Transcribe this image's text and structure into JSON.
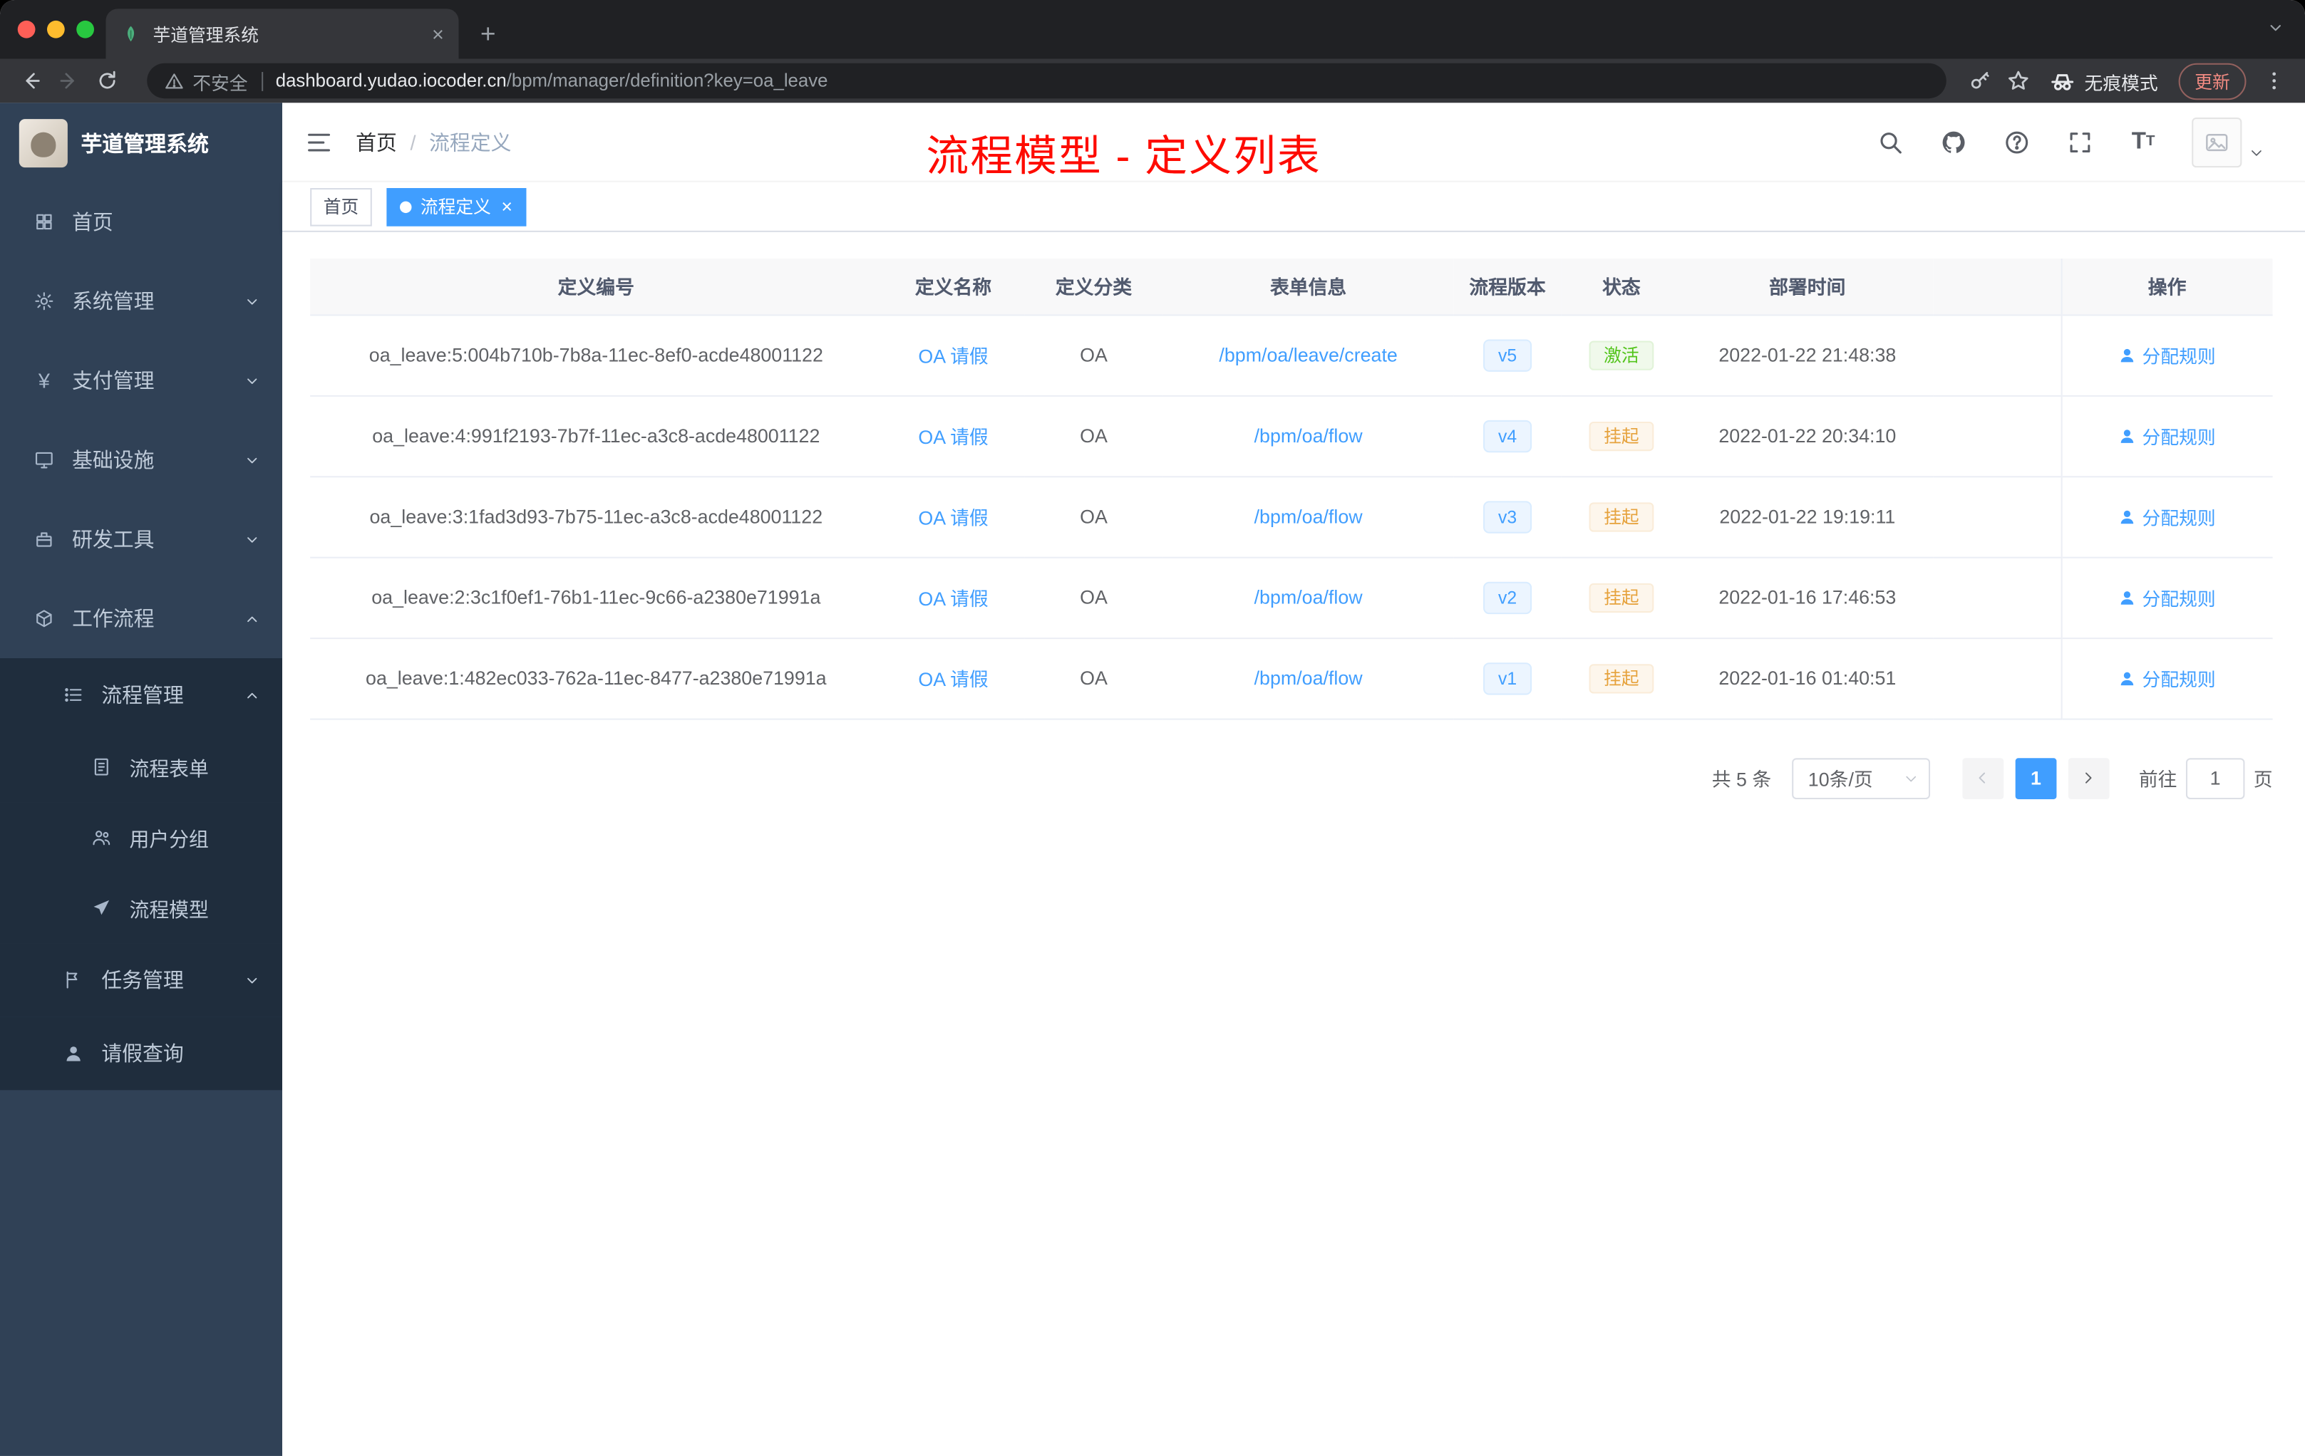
{
  "browser": {
    "tab": {
      "title": "芋道管理系统"
    },
    "address": {
      "security_label": "不安全",
      "url_domain": "dashboard.yudao.iocoder.cn",
      "url_path": "/bpm/manager/definition?key=oa_leave"
    },
    "incognito_label": "无痕模式",
    "update_label": "更新"
  },
  "sidebar": {
    "logo_title": "芋道管理系统",
    "items": [
      {
        "id": "home",
        "label": "首页",
        "icon": "dashboard-icon",
        "level": 1
      },
      {
        "id": "system",
        "label": "系统管理",
        "icon": "gear-icon",
        "level": 1,
        "arrow": "down"
      },
      {
        "id": "payment",
        "label": "支付管理",
        "icon": "yen-icon",
        "level": 1,
        "arrow": "down"
      },
      {
        "id": "infra",
        "label": "基础设施",
        "icon": "infra-icon",
        "level": 1,
        "arrow": "down"
      },
      {
        "id": "devtools",
        "label": "研发工具",
        "icon": "tools-icon",
        "level": 1,
        "arrow": "down"
      },
      {
        "id": "workflow",
        "label": "工作流程",
        "icon": "workflow-icon",
        "level": 1,
        "arrow": "up"
      },
      {
        "id": "process-manage",
        "label": "流程管理",
        "icon": "list-icon",
        "level": 2,
        "arrow": "up",
        "dark": true
      },
      {
        "id": "process-form",
        "label": "流程表单",
        "icon": "form-icon",
        "level": 3,
        "dark": true
      },
      {
        "id": "user-group",
        "label": "用户分组",
        "icon": "user-group-icon",
        "level": 3,
        "dark": true
      },
      {
        "id": "process-model",
        "label": "流程模型",
        "icon": "paper-plane-icon",
        "level": 3,
        "dark": true
      },
      {
        "id": "task-manage",
        "label": "任务管理",
        "icon": "flag-icon",
        "level": 2,
        "arrow": "down",
        "dark": true
      },
      {
        "id": "leave-query",
        "label": "请假查询",
        "icon": "person-icon",
        "level": 2,
        "dark": true
      }
    ]
  },
  "navbar": {
    "breadcrumb_home": "首页",
    "breadcrumb_separator": "/",
    "breadcrumb_current": "流程定义",
    "annotation": "流程模型 - 定义列表"
  },
  "tags": {
    "home_label": "首页",
    "active_label": "流程定义"
  },
  "table": {
    "columns": [
      "定义编号",
      "定义名称",
      "定义分类",
      "表单信息",
      "流程版本",
      "状态",
      "部署时间",
      "操作"
    ],
    "rows": [
      {
        "id": "oa_leave:5:004b710b-7b8a-11ec-8ef0-acde48001122",
        "name": "OA 请假",
        "category": "OA",
        "form": "/bpm/oa/leave/create",
        "version": "v5",
        "status": "激活",
        "status_type": "success",
        "time": "2022-01-22 21:48:38",
        "action": "分配规则"
      },
      {
        "id": "oa_leave:4:991f2193-7b7f-11ec-a3c8-acde48001122",
        "name": "OA 请假",
        "category": "OA",
        "form": "/bpm/oa/flow",
        "version": "v4",
        "status": "挂起",
        "status_type": "warning",
        "time": "2022-01-22 20:34:10",
        "action": "分配规则"
      },
      {
        "id": "oa_leave:3:1fad3d93-7b75-11ec-a3c8-acde48001122",
        "name": "OA 请假",
        "category": "OA",
        "form": "/bpm/oa/flow",
        "version": "v3",
        "status": "挂起",
        "status_type": "warning",
        "time": "2022-01-22 19:19:11",
        "action": "分配规则"
      },
      {
        "id": "oa_leave:2:3c1f0ef1-76b1-11ec-9c66-a2380e71991a",
        "name": "OA 请假",
        "category": "OA",
        "form": "/bpm/oa/flow",
        "version": "v2",
        "status": "挂起",
        "status_type": "warning",
        "time": "2022-01-16 17:46:53",
        "action": "分配规则"
      },
      {
        "id": "oa_leave:1:482ec033-762a-11ec-8477-a2380e71991a",
        "name": "OA 请假",
        "category": "OA",
        "form": "/bpm/oa/flow",
        "version": "v1",
        "status": "挂起",
        "status_type": "warning",
        "time": "2022-01-16 01:40:51",
        "action": "分配规则"
      }
    ]
  },
  "pagination": {
    "total_label": "共 5 条",
    "page_size_label": "10条/页",
    "current_page": "1",
    "goto_label": "前往",
    "goto_value": "1",
    "page_unit": "页"
  },
  "colors": {
    "accent_blue": "#409eff",
    "sidebar_bg": "#304156",
    "submenu_bg": "#1f2d3d",
    "success_text": "#52c41a",
    "warning_text": "#e6a23c",
    "annotation_red": "#fe0b00"
  }
}
